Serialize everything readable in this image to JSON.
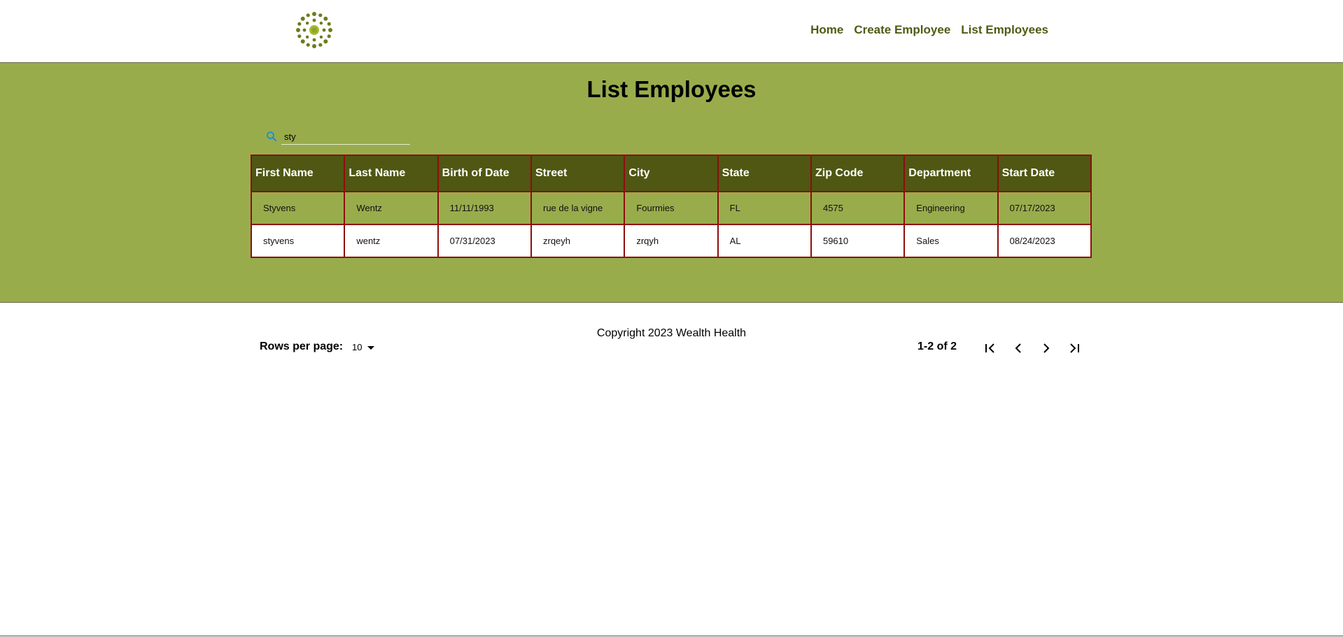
{
  "brand": {
    "logo_icon": "sun-flower-logo-icon",
    "color": "#6b7d1c"
  },
  "nav": {
    "home": "Home",
    "create_employee": "Create Employee",
    "list_employees": "List Employees"
  },
  "page": {
    "title": "List Employees"
  },
  "search": {
    "value": "sty",
    "icon": "search-icon"
  },
  "table": {
    "columns": [
      "First Name",
      "Last Name",
      "Birth of Date",
      "Street",
      "City",
      "State",
      "Zip Code",
      "Department",
      "Start Date"
    ],
    "rows": [
      [
        "Styvens",
        "Wentz",
        "11/11/1993",
        "rue de la vigne",
        "Fourmies",
        "FL",
        "4575",
        "Engineering",
        "07/17/2023"
      ],
      [
        "styvens",
        "wentz",
        "07/31/2023",
        "zrqeyh",
        "zrqyh",
        "AL",
        "59610",
        "Sales",
        "08/24/2023"
      ]
    ]
  },
  "pagination": {
    "rows_per_page_label": "Rows per page:",
    "rows_per_page_value": "10",
    "range": "1-2 of 2"
  },
  "footer": {
    "copyright": "Copyright 2023 Wealth Health"
  },
  "colors": {
    "main_bg": "#99ac4c",
    "header_cell_bg": "#4f5713",
    "border": "#8e0e0e",
    "nav_link": "#4f5b13"
  }
}
